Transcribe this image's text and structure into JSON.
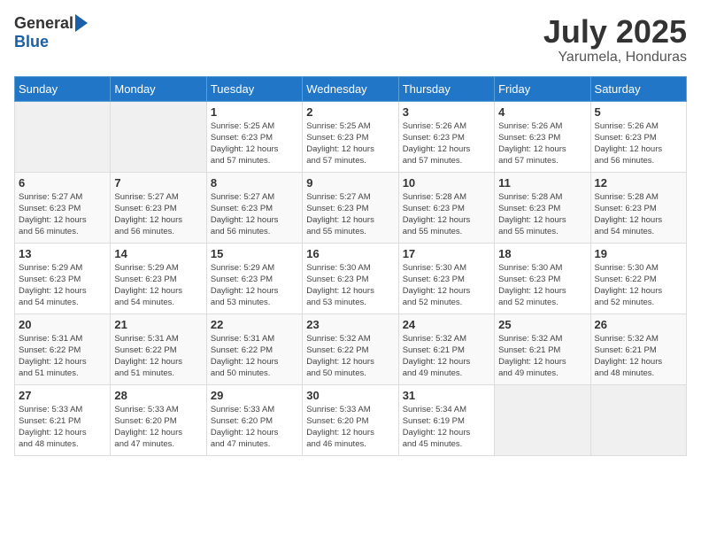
{
  "header": {
    "logo_general": "General",
    "logo_blue": "Blue",
    "month": "July 2025",
    "location": "Yarumela, Honduras"
  },
  "weekdays": [
    "Sunday",
    "Monday",
    "Tuesday",
    "Wednesday",
    "Thursday",
    "Friday",
    "Saturday"
  ],
  "weeks": [
    [
      {
        "day": "",
        "info": ""
      },
      {
        "day": "",
        "info": ""
      },
      {
        "day": "1",
        "info": "Sunrise: 5:25 AM\nSunset: 6:23 PM\nDaylight: 12 hours\nand 57 minutes."
      },
      {
        "day": "2",
        "info": "Sunrise: 5:25 AM\nSunset: 6:23 PM\nDaylight: 12 hours\nand 57 minutes."
      },
      {
        "day": "3",
        "info": "Sunrise: 5:26 AM\nSunset: 6:23 PM\nDaylight: 12 hours\nand 57 minutes."
      },
      {
        "day": "4",
        "info": "Sunrise: 5:26 AM\nSunset: 6:23 PM\nDaylight: 12 hours\nand 57 minutes."
      },
      {
        "day": "5",
        "info": "Sunrise: 5:26 AM\nSunset: 6:23 PM\nDaylight: 12 hours\nand 56 minutes."
      }
    ],
    [
      {
        "day": "6",
        "info": "Sunrise: 5:27 AM\nSunset: 6:23 PM\nDaylight: 12 hours\nand 56 minutes."
      },
      {
        "day": "7",
        "info": "Sunrise: 5:27 AM\nSunset: 6:23 PM\nDaylight: 12 hours\nand 56 minutes."
      },
      {
        "day": "8",
        "info": "Sunrise: 5:27 AM\nSunset: 6:23 PM\nDaylight: 12 hours\nand 56 minutes."
      },
      {
        "day": "9",
        "info": "Sunrise: 5:27 AM\nSunset: 6:23 PM\nDaylight: 12 hours\nand 55 minutes."
      },
      {
        "day": "10",
        "info": "Sunrise: 5:28 AM\nSunset: 6:23 PM\nDaylight: 12 hours\nand 55 minutes."
      },
      {
        "day": "11",
        "info": "Sunrise: 5:28 AM\nSunset: 6:23 PM\nDaylight: 12 hours\nand 55 minutes."
      },
      {
        "day": "12",
        "info": "Sunrise: 5:28 AM\nSunset: 6:23 PM\nDaylight: 12 hours\nand 54 minutes."
      }
    ],
    [
      {
        "day": "13",
        "info": "Sunrise: 5:29 AM\nSunset: 6:23 PM\nDaylight: 12 hours\nand 54 minutes."
      },
      {
        "day": "14",
        "info": "Sunrise: 5:29 AM\nSunset: 6:23 PM\nDaylight: 12 hours\nand 54 minutes."
      },
      {
        "day": "15",
        "info": "Sunrise: 5:29 AM\nSunset: 6:23 PM\nDaylight: 12 hours\nand 53 minutes."
      },
      {
        "day": "16",
        "info": "Sunrise: 5:30 AM\nSunset: 6:23 PM\nDaylight: 12 hours\nand 53 minutes."
      },
      {
        "day": "17",
        "info": "Sunrise: 5:30 AM\nSunset: 6:23 PM\nDaylight: 12 hours\nand 52 minutes."
      },
      {
        "day": "18",
        "info": "Sunrise: 5:30 AM\nSunset: 6:23 PM\nDaylight: 12 hours\nand 52 minutes."
      },
      {
        "day": "19",
        "info": "Sunrise: 5:30 AM\nSunset: 6:22 PM\nDaylight: 12 hours\nand 52 minutes."
      }
    ],
    [
      {
        "day": "20",
        "info": "Sunrise: 5:31 AM\nSunset: 6:22 PM\nDaylight: 12 hours\nand 51 minutes."
      },
      {
        "day": "21",
        "info": "Sunrise: 5:31 AM\nSunset: 6:22 PM\nDaylight: 12 hours\nand 51 minutes."
      },
      {
        "day": "22",
        "info": "Sunrise: 5:31 AM\nSunset: 6:22 PM\nDaylight: 12 hours\nand 50 minutes."
      },
      {
        "day": "23",
        "info": "Sunrise: 5:32 AM\nSunset: 6:22 PM\nDaylight: 12 hours\nand 50 minutes."
      },
      {
        "day": "24",
        "info": "Sunrise: 5:32 AM\nSunset: 6:21 PM\nDaylight: 12 hours\nand 49 minutes."
      },
      {
        "day": "25",
        "info": "Sunrise: 5:32 AM\nSunset: 6:21 PM\nDaylight: 12 hours\nand 49 minutes."
      },
      {
        "day": "26",
        "info": "Sunrise: 5:32 AM\nSunset: 6:21 PM\nDaylight: 12 hours\nand 48 minutes."
      }
    ],
    [
      {
        "day": "27",
        "info": "Sunrise: 5:33 AM\nSunset: 6:21 PM\nDaylight: 12 hours\nand 48 minutes."
      },
      {
        "day": "28",
        "info": "Sunrise: 5:33 AM\nSunset: 6:20 PM\nDaylight: 12 hours\nand 47 minutes."
      },
      {
        "day": "29",
        "info": "Sunrise: 5:33 AM\nSunset: 6:20 PM\nDaylight: 12 hours\nand 47 minutes."
      },
      {
        "day": "30",
        "info": "Sunrise: 5:33 AM\nSunset: 6:20 PM\nDaylight: 12 hours\nand 46 minutes."
      },
      {
        "day": "31",
        "info": "Sunrise: 5:34 AM\nSunset: 6:19 PM\nDaylight: 12 hours\nand 45 minutes."
      },
      {
        "day": "",
        "info": ""
      },
      {
        "day": "",
        "info": ""
      }
    ]
  ]
}
